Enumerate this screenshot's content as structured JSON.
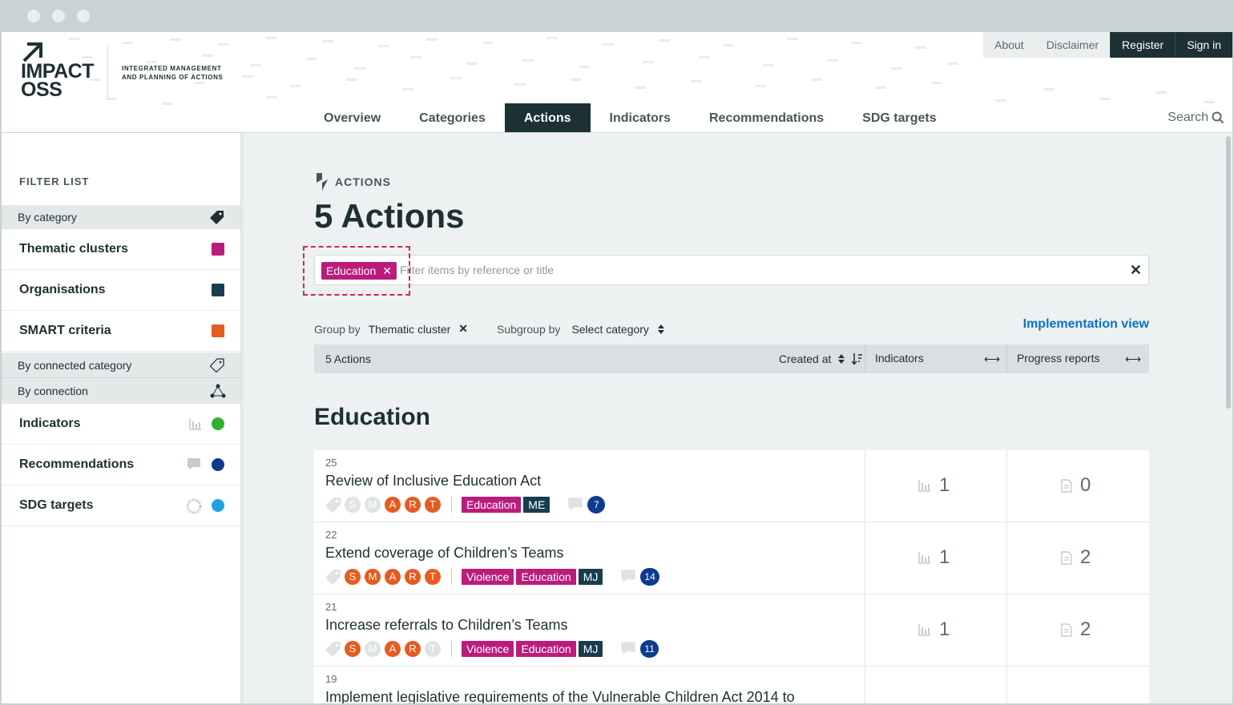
{
  "header": {
    "logo_line1": "IMPACT",
    "logo_line2": "OSS",
    "claim_line1": "INTEGRATED MANAGEMENT",
    "claim_line2": "AND PLANNING OF ACTIONS",
    "top_links": [
      "About",
      "Disclaimer",
      "Register",
      "Sign in"
    ],
    "main_nav": [
      "Overview",
      "Categories",
      "Actions",
      "Indicators",
      "Recommendations",
      "SDG targets"
    ],
    "active_nav": "Actions",
    "search_label": "Search"
  },
  "sidebar": {
    "title": "FILTER LIST",
    "by_category": "By category",
    "category_options": [
      {
        "label": "Thematic clusters",
        "color": "#bb1c7c"
      },
      {
        "label": "Organisations",
        "color": "#173d4f"
      },
      {
        "label": "SMART criteria",
        "color": "#e65b1f"
      }
    ],
    "by_connected_category": "By connected category",
    "by_connection": "By connection",
    "connection_options": [
      {
        "label": "Indicators",
        "color": "#2fb22b",
        "icon": "bar-chart-icon"
      },
      {
        "label": "Recommendations",
        "color": "#0d3b8f",
        "icon": "comment-icon"
      },
      {
        "label": "SDG targets",
        "color": "#1ea4e0",
        "icon": "sdg-wheel-icon"
      }
    ]
  },
  "main": {
    "section_label": "ACTIONS",
    "page_title": "5 Actions",
    "filter_chip": "Education",
    "filter_placeholder": "Filter items by reference or title",
    "group_by_label": "Group by",
    "group_by_value": "Thematic cluster",
    "subgroup_by_label": "Subgroup by",
    "subgroup_by_value": "Select category",
    "implementation_view": "Implementation view",
    "list_header": {
      "count": "5 Actions",
      "sort_label": "Created at",
      "col_indicators": "Indicators",
      "col_progress": "Progress reports"
    },
    "group_title": "Education",
    "items": [
      {
        "ref": "25",
        "title": "Review of Inclusive Education Act",
        "smart": [
          "S",
          "M",
          "A",
          "R",
          "T"
        ],
        "smart_on": [
          false,
          false,
          true,
          true,
          true
        ],
        "categories": [
          "Education",
          "ME"
        ],
        "comments": "7",
        "indicators": "1",
        "progress": "0"
      },
      {
        "ref": "22",
        "title": "Extend coverage of Children’s Teams",
        "smart": [
          "S",
          "M",
          "A",
          "R",
          "T"
        ],
        "smart_on": [
          true,
          true,
          true,
          true,
          true
        ],
        "categories": [
          "Violence",
          "Education",
          "MJ"
        ],
        "comments": "14",
        "indicators": "1",
        "progress": "2"
      },
      {
        "ref": "21",
        "title": "Increase referrals to Children’s Teams",
        "smart": [
          "S",
          "M",
          "A",
          "R",
          "T"
        ],
        "smart_on": [
          true,
          false,
          true,
          true,
          false
        ],
        "categories": [
          "Violence",
          "Education",
          "MJ"
        ],
        "comments": "11",
        "indicators": "1",
        "progress": "2"
      },
      {
        "ref": "19",
        "title": "Implement legislative requirements of the Vulnerable Children Act 2014 to"
      }
    ]
  }
}
